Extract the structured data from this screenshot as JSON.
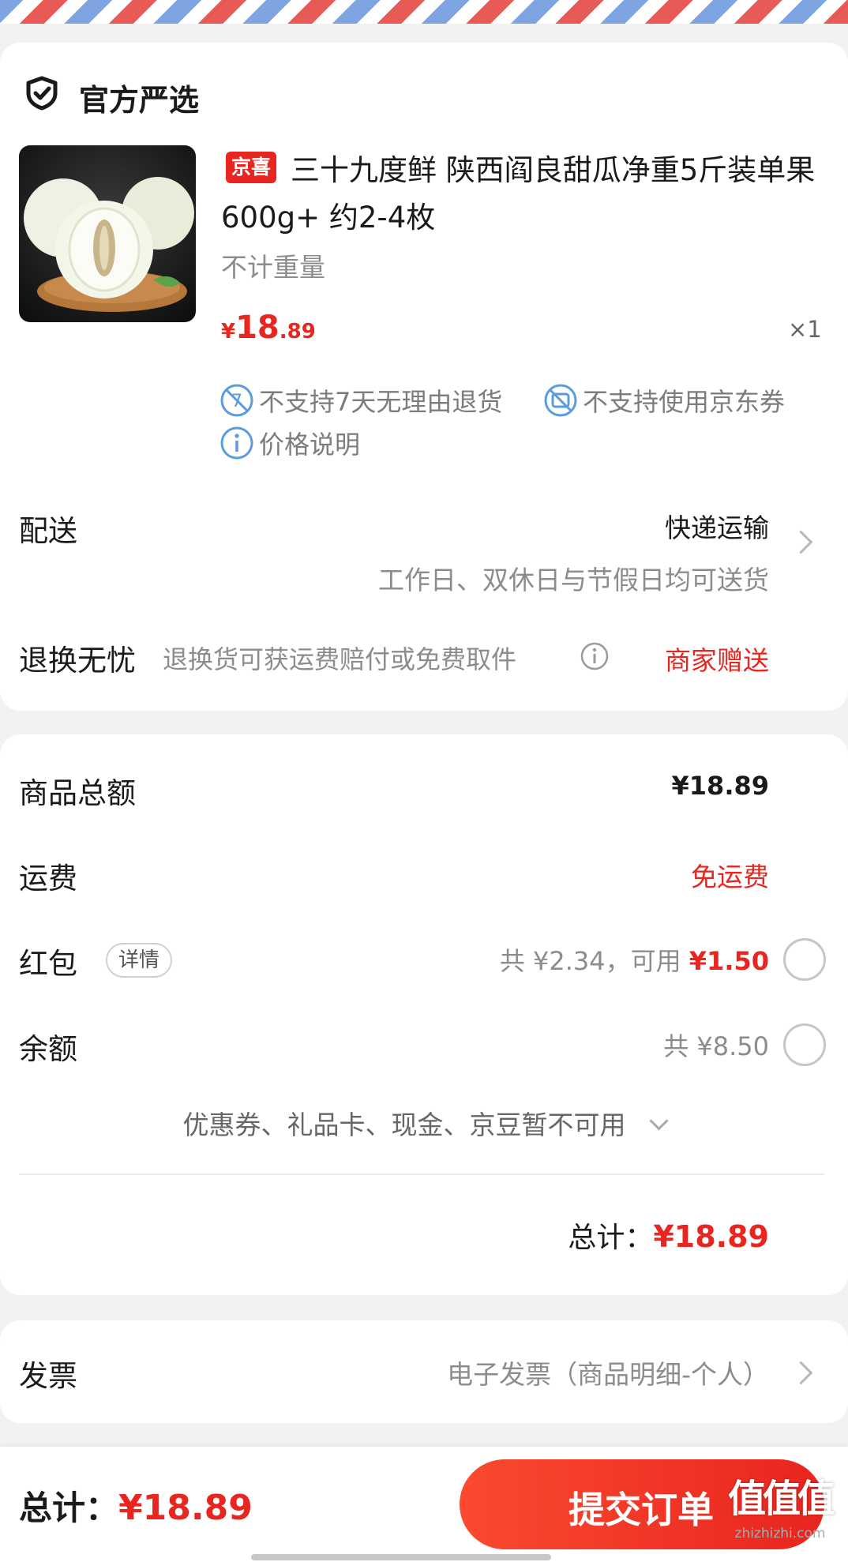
{
  "store": {
    "label": "官方严选"
  },
  "product": {
    "badge": "京喜",
    "title": "三十九度鲜 陕西阎良甜瓜净重5斤装单果600g+ 约2-4枚",
    "spec": "不计重量",
    "price_symbol": "¥",
    "price_int": "18",
    "price_dec": ".89",
    "quantity": "×1",
    "tags": [
      {
        "icon": "no-return-icon",
        "text": "不支持7天无理由退货"
      },
      {
        "icon": "no-coupon-icon",
        "text": "不支持使用京东券"
      },
      {
        "icon": "info-icon",
        "text": "价格说明"
      }
    ]
  },
  "delivery": {
    "label": "配送",
    "method": "快递运输",
    "note": "工作日、双休日与节假日均可送货"
  },
  "returns": {
    "label": "退换无忧",
    "desc": "退换货可获运费赔付或免费取件",
    "value": "商家赠送"
  },
  "summary": {
    "goods_total_label": "商品总额",
    "goods_total_value": "¥18.89",
    "shipping_label": "运费",
    "shipping_value": "免运费",
    "redpacket_label": "红包",
    "redpacket_detail": "详情",
    "redpacket_info": "共 ¥2.34，可用 ",
    "redpacket_usable": "¥1.50",
    "balance_label": "余额",
    "balance_info": "共 ¥8.50",
    "unavailable": "优惠券、礼品卡、现金、京豆暂不可用",
    "total_label": "总计：",
    "total_value": "¥18.89"
  },
  "invoice": {
    "label": "发票",
    "value": "电子发票（商品明细-个人）"
  },
  "bottom": {
    "total_label": "总计：",
    "total_value": "¥18.89",
    "submit": "提交订单",
    "watermark": "值值值",
    "watermark_url": "zhizhizhi.com"
  },
  "colors": {
    "accent": "#e8251f",
    "icon_blue": "#5b9be0"
  }
}
